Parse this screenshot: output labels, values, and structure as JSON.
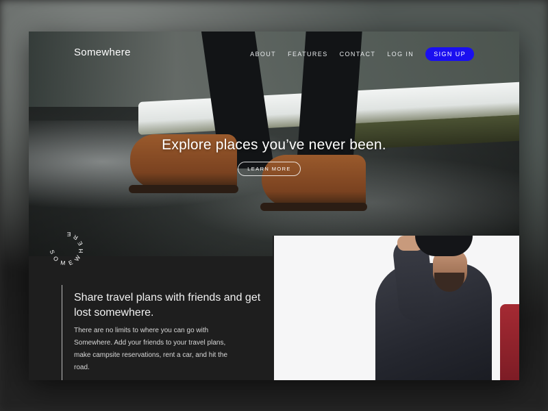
{
  "brand": {
    "name": "Somewhere",
    "accent": "#1a0ff0"
  },
  "nav": {
    "links": [
      "ABOUT",
      "FEATURES",
      "CONTACT",
      "LOG IN"
    ],
    "signup_label": "SIGN UP"
  },
  "hero": {
    "headline": "Explore places you’ve never been.",
    "cta_label": "LEARN MORE"
  },
  "badge": {
    "text": "SOMEWHERE"
  },
  "info": {
    "title": "Share travel plans with friends and get lost somewhere.",
    "body": "There are no limits to where you can go with Somewhere. Add your friends to your travel plans, make campsite reservations, rent a car, and hit the road."
  }
}
